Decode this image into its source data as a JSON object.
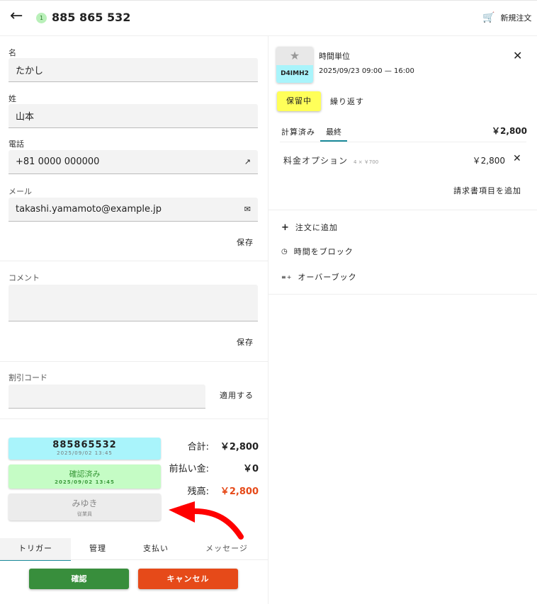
{
  "header": {
    "badge": "1",
    "order_number": "885 865 532",
    "new_order": "新規注文"
  },
  "customer": {
    "first_name_label": "名",
    "first_name": "たかし",
    "last_name_label": "姓",
    "last_name": "山本",
    "phone_label": "電話",
    "phone": "+81 0000 000000",
    "email_label": "メール",
    "email": "takashi.yamamoto@example.jp",
    "save": "保存"
  },
  "comment": {
    "label": "コメント",
    "value": "",
    "save": "保存"
  },
  "discount": {
    "label": "割引コード",
    "value": "",
    "apply": "適用する"
  },
  "status_cards": [
    {
      "title": "885865532",
      "sub": "2025/09/02 13:45"
    },
    {
      "title": "確認済み",
      "sub": "2025/09/02 13:45"
    },
    {
      "title": "みゆき",
      "sub": "従業員"
    }
  ],
  "totals": {
    "total_label": "合計:",
    "total": "￥2,800",
    "prepaid_label": "前払い金:",
    "prepaid": "￥0",
    "balance_label": "残高:",
    "balance": "￥2,800"
  },
  "bottom_tabs": [
    "トリガー",
    "管理",
    "支払い",
    "メッセージ"
  ],
  "actions": {
    "confirm": "確認",
    "cancel": "キャンセル"
  },
  "booking": {
    "code": "D4IMH2",
    "title": "時間単位",
    "datetime": "2025/09/23 09:00 — 16:00",
    "status": "保留中",
    "repeat": "繰り返す",
    "tabs": [
      "計算済み",
      "最終"
    ],
    "tab_total": "￥2,800",
    "line_item": {
      "name": "料金オプション",
      "detail": "4 × ￥700",
      "price": "￥2,800"
    },
    "add_invoice_item": "請求書項目を追加"
  },
  "menu": [
    "注文に追加",
    "時間をブロック",
    "オーバーブック"
  ],
  "colors": {
    "accent": "#1a8a9a",
    "confirm": "#388e3c",
    "cancel": "#e64a19",
    "balance": "#e64a19",
    "pending": "#ffff59"
  }
}
